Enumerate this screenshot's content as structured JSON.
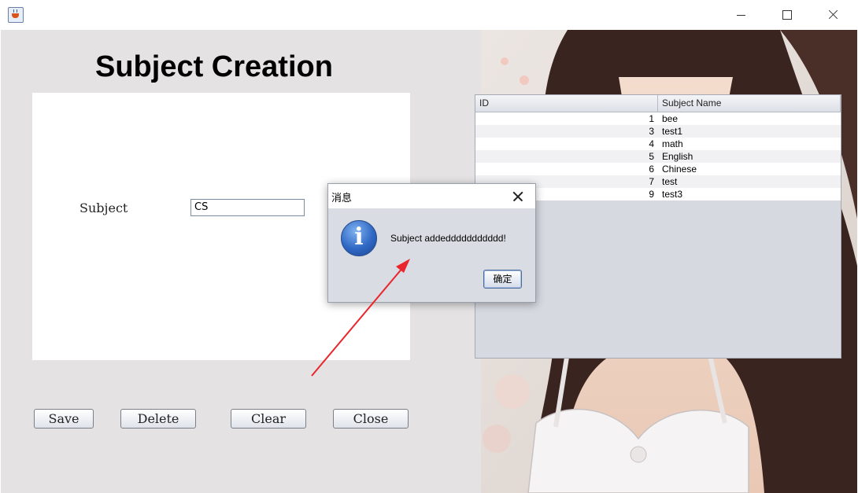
{
  "window": {
    "controls": [
      "minimize-icon",
      "maximize-icon",
      "close-icon"
    ]
  },
  "form": {
    "heading": "Subject Creation",
    "subject_label": "Subject",
    "subject_value": "CS"
  },
  "buttons": {
    "save": "Save",
    "delete": "Delete",
    "clear": "Clear",
    "close": "Close"
  },
  "table": {
    "headers": [
      "ID",
      "Subject Name"
    ],
    "rows": [
      {
        "id": "1",
        "name": "bee"
      },
      {
        "id": "3",
        "name": "test1"
      },
      {
        "id": "4",
        "name": "math"
      },
      {
        "id": "5",
        "name": "English"
      },
      {
        "id": "6",
        "name": "Chinese"
      },
      {
        "id": "7",
        "name": "test"
      },
      {
        "id": "9",
        "name": "test3"
      }
    ]
  },
  "dialog": {
    "title": "消息",
    "message": "Subject addeddddddddddd!",
    "ok_label": "确定",
    "icon": "info-icon"
  },
  "colors": {
    "content_bg": "#e4e2e2",
    "dialog_bg": "#d9dce3",
    "arrow": "#e8262b"
  }
}
